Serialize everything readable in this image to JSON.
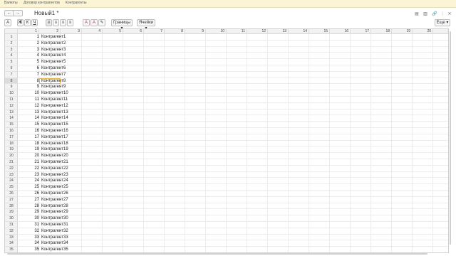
{
  "topnav": [
    "Валюты",
    "Договор контрагентов",
    "Контрагенты"
  ],
  "document": {
    "title": "Новый1 *"
  },
  "toolbar": {
    "borders_label": "Границы",
    "cells_label": "Ячейки",
    "more_label": "Еще"
  },
  "grid": {
    "columns": [
      "1",
      "2",
      "3",
      "4",
      "5",
      "6",
      "7",
      "8",
      "9",
      "10",
      "11",
      "12",
      "13",
      "14",
      "15",
      "16",
      "17",
      "18",
      "19",
      "20",
      "21"
    ],
    "rows": [
      {
        "rownum": "1",
        "num": "1",
        "name": "Контрагент1"
      },
      {
        "rownum": "2",
        "num": "2",
        "name": "Контрагент2"
      },
      {
        "rownum": "3",
        "num": "3",
        "name": "Контрагент3"
      },
      {
        "rownum": "4",
        "num": "4",
        "name": "Контрагент4"
      },
      {
        "rownum": "5",
        "num": "5",
        "name": "Контрагент5"
      },
      {
        "rownum": "6",
        "num": "6",
        "name": "Контрагент6"
      },
      {
        "rownum": "7",
        "num": "7",
        "name": "Контрагент7"
      },
      {
        "rownum": "8",
        "num": "8",
        "name": "Контрагент8"
      },
      {
        "rownum": "9",
        "num": "9",
        "name": "Контрагент9"
      },
      {
        "rownum": "10",
        "num": "10",
        "name": "Контрагент10"
      },
      {
        "rownum": "11",
        "num": "11",
        "name": "Контрагент11"
      },
      {
        "rownum": "12",
        "num": "12",
        "name": "Контрагент12"
      },
      {
        "rownum": "13",
        "num": "13",
        "name": "Контрагент13"
      },
      {
        "rownum": "14",
        "num": "14",
        "name": "Контрагент14"
      },
      {
        "rownum": "15",
        "num": "15",
        "name": "Контрагент15"
      },
      {
        "rownum": "16",
        "num": "16",
        "name": "Контрагент16"
      },
      {
        "rownum": "17",
        "num": "17",
        "name": "Контрагент17"
      },
      {
        "rownum": "18",
        "num": "18",
        "name": "Контрагент18"
      },
      {
        "rownum": "19",
        "num": "19",
        "name": "Контрагент19"
      },
      {
        "rownum": "20",
        "num": "20",
        "name": "Контрагент20"
      },
      {
        "rownum": "21",
        "num": "21",
        "name": "Контрагент21"
      },
      {
        "rownum": "22",
        "num": "22",
        "name": "Контрагент22"
      },
      {
        "rownum": "23",
        "num": "23",
        "name": "Контрагент23"
      },
      {
        "rownum": "24",
        "num": "24",
        "name": "Контрагент24"
      },
      {
        "rownum": "25",
        "num": "25",
        "name": "Контрагент25"
      },
      {
        "rownum": "26",
        "num": "26",
        "name": "Контрагент26"
      },
      {
        "rownum": "27",
        "num": "27",
        "name": "Контрагент27"
      },
      {
        "rownum": "28",
        "num": "28",
        "name": "Контрагент28"
      },
      {
        "rownum": "29",
        "num": "29",
        "name": "Контрагент29"
      },
      {
        "rownum": "30",
        "num": "30",
        "name": "Контрагент30"
      },
      {
        "rownum": "31",
        "num": "31",
        "name": "Контрагент31"
      },
      {
        "rownum": "32",
        "num": "32",
        "name": "Контрагент32"
      },
      {
        "rownum": "33",
        "num": "33",
        "name": "Контрагент33"
      },
      {
        "rownum": "34",
        "num": "34",
        "name": "Контрагент34"
      },
      {
        "rownum": "35",
        "num": "35",
        "name": "Контрагент35"
      }
    ],
    "selected_row": "8",
    "selection_color": "#e3b84a"
  }
}
